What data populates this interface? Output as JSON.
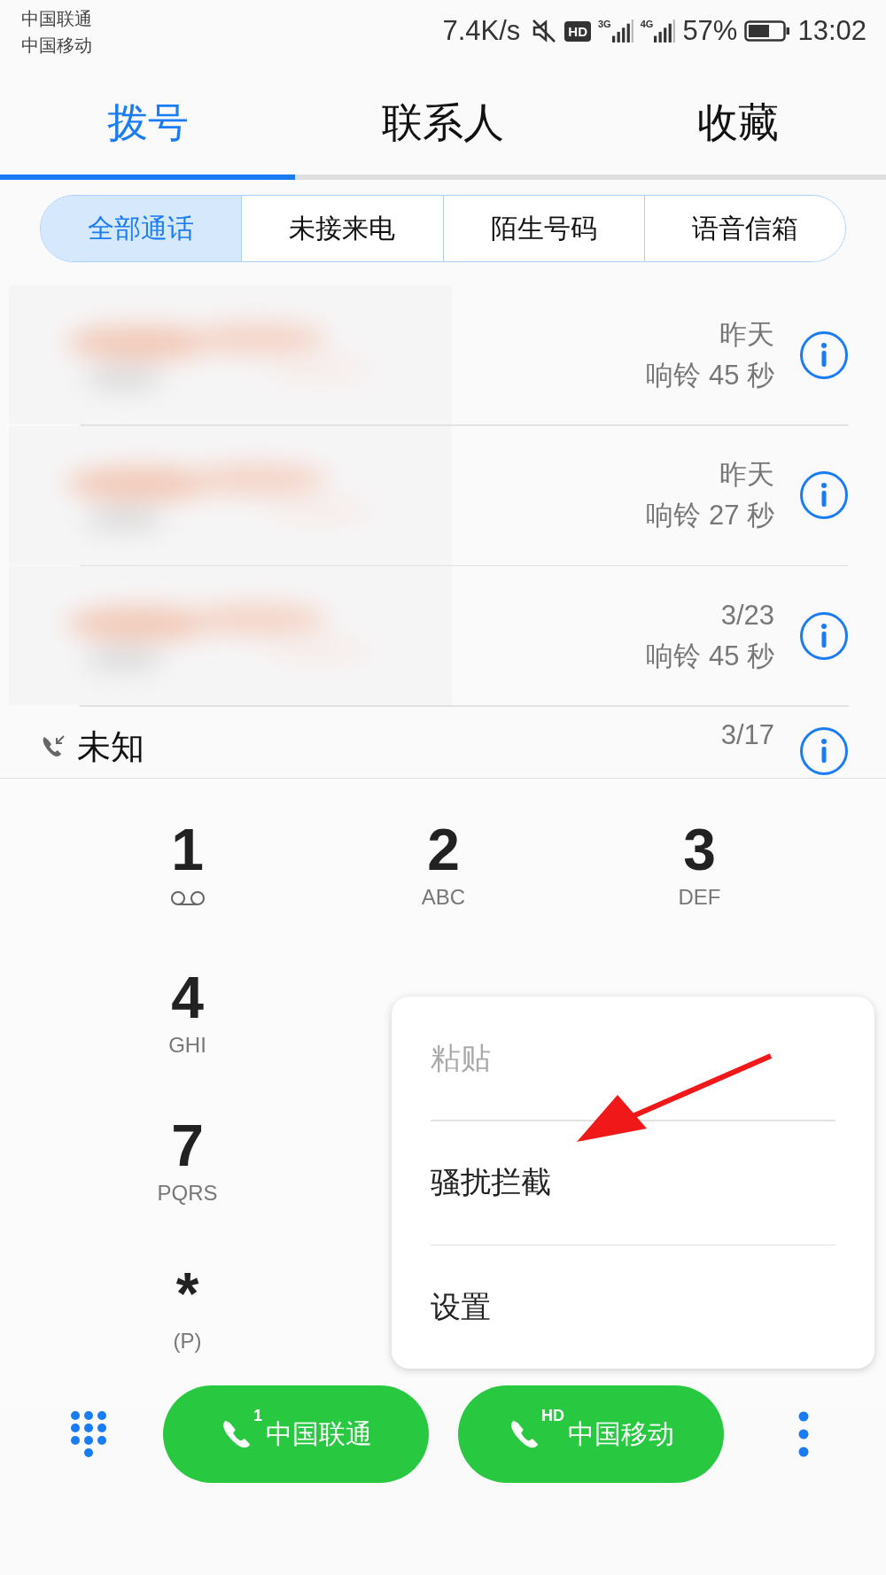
{
  "status_bar": {
    "carriers": [
      "中国联通",
      "中国移动"
    ],
    "net_speed": "7.4K/s",
    "hd_badge": "HD",
    "networks": [
      "3G",
      "4G"
    ],
    "battery_text": "57%",
    "time": "13:02"
  },
  "tabs": [
    {
      "label": "拨号",
      "selected": true
    },
    {
      "label": "联系人",
      "selected": false
    },
    {
      "label": "收藏",
      "selected": false
    }
  ],
  "filters": [
    {
      "label": "全部通话",
      "selected": true
    },
    {
      "label": "未接来电",
      "selected": false
    },
    {
      "label": "陌生号码",
      "selected": false
    },
    {
      "label": "语音信箱",
      "selected": false
    }
  ],
  "calls": [
    {
      "kind": "blurred",
      "date": "昨天",
      "detail": "响铃 45 秒"
    },
    {
      "kind": "blurred",
      "date": "昨天",
      "detail": "响铃 27 秒"
    },
    {
      "kind": "blurred",
      "date": "3/23",
      "detail": "响铃 45 秒"
    },
    {
      "kind": "named",
      "name": "未知",
      "date": "3/17"
    }
  ],
  "dialpad": {
    "rows": [
      [
        {
          "digit": "1",
          "kind": "voicemail"
        },
        {
          "digit": "2",
          "kind": "letters",
          "letters": "ABC"
        },
        {
          "digit": "3",
          "kind": "letters",
          "letters": "DEF"
        }
      ],
      [
        {
          "digit": "4",
          "kind": "letters",
          "letters": "GHI"
        }
      ],
      [
        {
          "digit": "7",
          "kind": "letters",
          "letters": "PQRS"
        }
      ],
      [
        {
          "digit": "*",
          "kind": "letters",
          "letters": "(P)"
        }
      ]
    ]
  },
  "menu": {
    "items": [
      {
        "label": "粘贴",
        "disabled": true
      },
      {
        "label": "骚扰拦截",
        "disabled": false
      },
      {
        "label": "设置",
        "disabled": false
      }
    ]
  },
  "call_buttons": [
    {
      "label": "中国联通",
      "badge": "1"
    },
    {
      "label": "中国移动",
      "badge": "HD"
    }
  ]
}
